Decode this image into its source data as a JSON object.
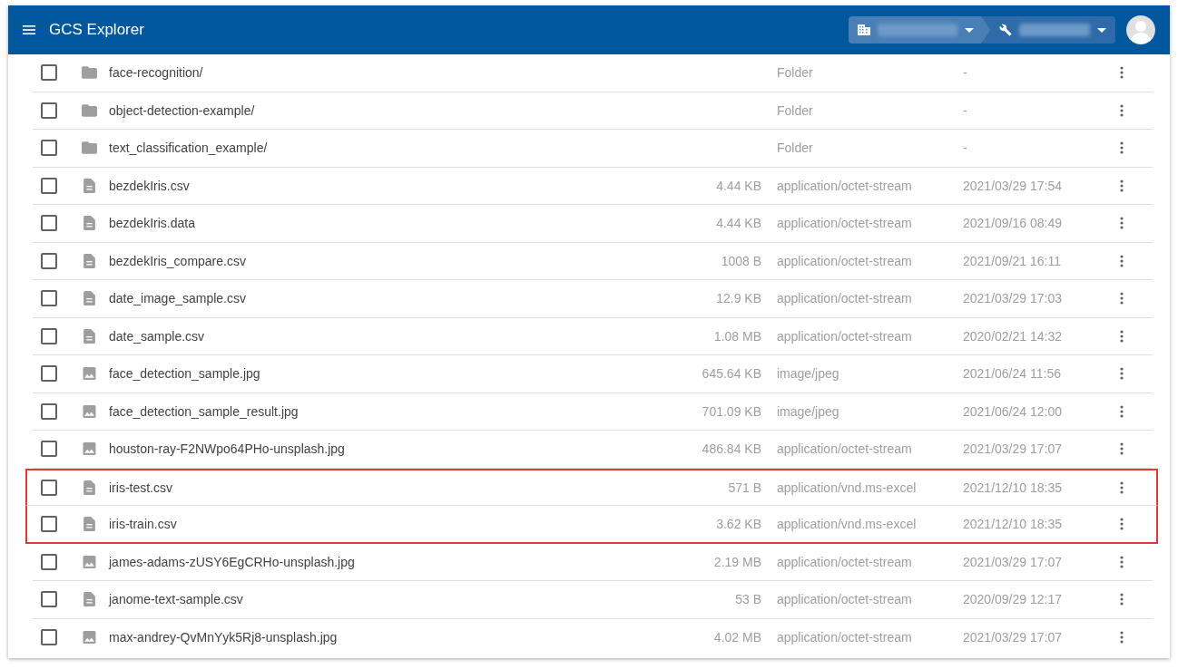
{
  "app_bar": {
    "title": "GCS Explorer"
  },
  "rows": [
    {
      "kind": "folder",
      "name": "face-recognition/",
      "size": "",
      "type": "Folder",
      "updated": "-",
      "checked": false,
      "highlighted": false
    },
    {
      "kind": "folder",
      "name": "object-detection-example/",
      "size": "",
      "type": "Folder",
      "updated": "-",
      "checked": false,
      "highlighted": false
    },
    {
      "kind": "folder",
      "name": "text_classification_example/",
      "size": "",
      "type": "Folder",
      "updated": "-",
      "checked": false,
      "highlighted": false
    },
    {
      "kind": "file",
      "name": "bezdekIris.csv",
      "size": "4.44 KB",
      "type": "application/octet-stream",
      "updated": "2021/03/29 17:54",
      "checked": false,
      "highlighted": false
    },
    {
      "kind": "file",
      "name": "bezdekIris.data",
      "size": "4.44 KB",
      "type": "application/octet-stream",
      "updated": "2021/09/16 08:49",
      "checked": false,
      "highlighted": false
    },
    {
      "kind": "file",
      "name": "bezdekIris_compare.csv",
      "size": "1008 B",
      "type": "application/octet-stream",
      "updated": "2021/09/21 16:11",
      "checked": false,
      "highlighted": false
    },
    {
      "kind": "file",
      "name": "date_image_sample.csv",
      "size": "12.9 KB",
      "type": "application/octet-stream",
      "updated": "2021/03/29 17:03",
      "checked": false,
      "highlighted": false
    },
    {
      "kind": "file",
      "name": "date_sample.csv",
      "size": "1.08 MB",
      "type": "application/octet-stream",
      "updated": "2020/02/21 14:32",
      "checked": false,
      "highlighted": false
    },
    {
      "kind": "image",
      "name": "face_detection_sample.jpg",
      "size": "645.64 KB",
      "type": "image/jpeg",
      "updated": "2021/06/24 11:56",
      "checked": false,
      "highlighted": false
    },
    {
      "kind": "image",
      "name": "face_detection_sample_result.jpg",
      "size": "701.09 KB",
      "type": "image/jpeg",
      "updated": "2021/06/24 12:00",
      "checked": false,
      "highlighted": false
    },
    {
      "kind": "image",
      "name": "houston-ray-F2NWpo64PHo-unsplash.jpg",
      "size": "486.84 KB",
      "type": "application/octet-stream",
      "updated": "2021/03/29 17:07",
      "checked": false,
      "highlighted": false
    },
    {
      "kind": "file",
      "name": "iris-test.csv",
      "size": "571 B",
      "type": "application/vnd.ms-excel",
      "updated": "2021/12/10 18:35",
      "checked": false,
      "highlighted": true
    },
    {
      "kind": "file",
      "name": "iris-train.csv",
      "size": "3.62 KB",
      "type": "application/vnd.ms-excel",
      "updated": "2021/12/10 18:35",
      "checked": false,
      "highlighted": true
    },
    {
      "kind": "image",
      "name": "james-adams-zUSY6EgCRHo-unsplash.jpg",
      "size": "2.19 MB",
      "type": "application/octet-stream",
      "updated": "2021/03/29 17:07",
      "checked": false,
      "highlighted": false
    },
    {
      "kind": "file",
      "name": "janome-text-sample.csv",
      "size": "53 B",
      "type": "application/octet-stream",
      "updated": "2020/09/29 12:17",
      "checked": false,
      "highlighted": false
    },
    {
      "kind": "image",
      "name": "max-andrey-QvMnYyk5Rj8-unsplash.jpg",
      "size": "4.02 MB",
      "type": "application/octet-stream",
      "updated": "2021/03/29 17:07",
      "checked": false,
      "highlighted": false
    }
  ]
}
